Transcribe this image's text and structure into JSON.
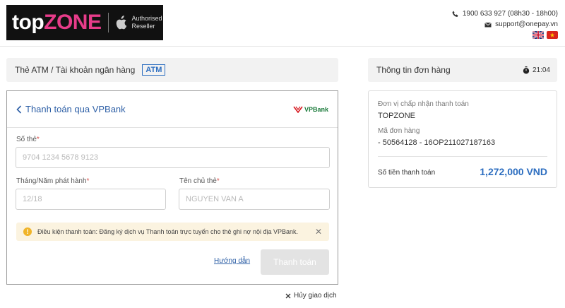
{
  "header": {
    "logo_top": "top",
    "logo_zone": "ZONE",
    "logo_authorised": "Authorised",
    "logo_reseller": "Reseller",
    "phone": "1900 633 927 (08h30 - 18h00)",
    "email": "support@onepay.vn"
  },
  "left": {
    "method_label": "Thẻ ATM / Tài khoản ngân hàng",
    "method_badge": "ATM",
    "back_label": "Thanh toán qua VPBank",
    "bank_logo": "VPBank",
    "card_number_label": "Số thẻ",
    "card_number_placeholder": "9704 1234 5678 9123",
    "issue_date_label": "Tháng/Năm phát hành",
    "issue_date_placeholder": "12/18",
    "holder_label": "Tên chủ thẻ",
    "holder_placeholder": "NGUYEN VAN A",
    "required_mark": "*",
    "notice": "Điều kiện thanh toán: Đăng ký dịch vụ Thanh toán trực tuyến cho thẻ ghi nợ nội địa VPBank.",
    "notice_close": "✕",
    "guide_link": "Hướng dẫn",
    "pay_button": "Thanh toán",
    "cancel_label": "Hủy giao dịch"
  },
  "right": {
    "title": "Thông tin đơn hàng",
    "timer": "21:04",
    "merchant_label": "Đơn vị chấp nhận thanh toán",
    "merchant_value": "TOPZONE",
    "order_label": "Mã đơn hàng",
    "order_value": "- 50564128 - 16OP211027187163",
    "amount_label": "Số tiền thanh toán",
    "amount_value": "1,272,000 VND"
  },
  "colors": {
    "accent": "#2d6ec0",
    "brand_pink": "#e83c8a",
    "notice_bg": "#fbf3e0"
  }
}
